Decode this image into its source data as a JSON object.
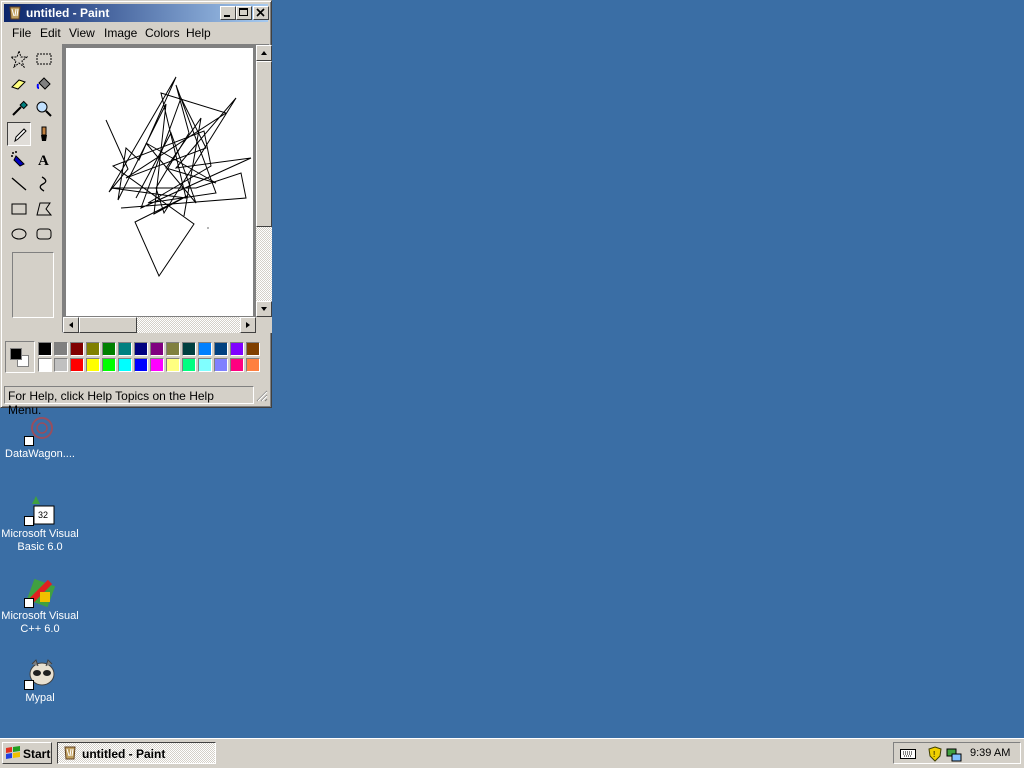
{
  "window": {
    "title": "untitled - Paint",
    "menu": [
      "File",
      "Edit",
      "View",
      "Image",
      "Colors",
      "Help"
    ],
    "status": "For Help, click Help Topics on the Help Menu."
  },
  "tools": [
    {
      "name": "free-form-select",
      "icon": "star-select-icon"
    },
    {
      "name": "select",
      "icon": "rect-select-icon"
    },
    {
      "name": "eraser",
      "icon": "eraser-icon"
    },
    {
      "name": "fill-with-color",
      "icon": "paint-bucket-icon"
    },
    {
      "name": "pick-color",
      "icon": "eyedropper-icon"
    },
    {
      "name": "magnifier",
      "icon": "magnifier-icon"
    },
    {
      "name": "pencil",
      "icon": "pencil-icon",
      "active": true
    },
    {
      "name": "brush",
      "icon": "brush-icon"
    },
    {
      "name": "airbrush",
      "icon": "airbrush-icon"
    },
    {
      "name": "text",
      "icon": "text-icon",
      "glyph": "A"
    },
    {
      "name": "line",
      "icon": "line-icon"
    },
    {
      "name": "curve",
      "icon": "curve-icon"
    },
    {
      "name": "rectangle",
      "icon": "rectangle-icon"
    },
    {
      "name": "polygon",
      "icon": "polygon-icon"
    },
    {
      "name": "ellipse",
      "icon": "ellipse-icon"
    },
    {
      "name": "rounded-rectangle",
      "icon": "rounded-rectangle-icon"
    }
  ],
  "palette": {
    "foreground": "#000000",
    "background": "#ffffff",
    "top_row": [
      "#000000",
      "#808080",
      "#800000",
      "#808000",
      "#008000",
      "#008080",
      "#000080",
      "#800080",
      "#808040",
      "#004040",
      "#0080ff",
      "#004080",
      "#8000ff",
      "#804000"
    ],
    "bottom_row": [
      "#ffffff",
      "#c0c0c0",
      "#ff0000",
      "#ffff00",
      "#00ff00",
      "#00ffff",
      "#0000ff",
      "#ff00ff",
      "#ffff80",
      "#00ff80",
      "#80ffff",
      "#8080ff",
      "#ff0080",
      "#ff8040"
    ]
  },
  "desktop_icons": [
    {
      "label": "DataWagon....",
      "icon": "datawagon-icon"
    },
    {
      "label": "Microsoft Visual Basic 6.0",
      "icon": "visual-basic-icon"
    },
    {
      "label": "Microsoft Visual C++ 6.0",
      "icon": "visual-cpp-icon"
    },
    {
      "label": "Mypal",
      "icon": "mypal-icon"
    }
  ],
  "taskbar": {
    "start_label": "Start",
    "task_label": "untitled - Paint",
    "clock": "9:39 AM",
    "tray_icons": [
      "keyboard-icon",
      "shield-icon",
      "network-icon"
    ]
  },
  "colors": {
    "desktop": "#3a6ea5",
    "face": "#d4d0c8",
    "title_active": "#0a246a"
  }
}
